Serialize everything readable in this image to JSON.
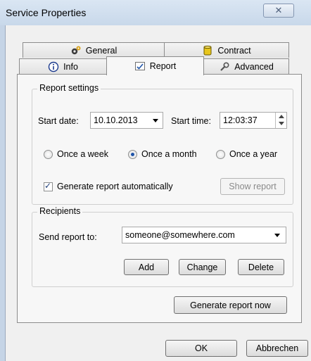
{
  "window": {
    "title": "Service Properties",
    "close_glyph": "✕"
  },
  "tabs_back": [
    {
      "label": "General",
      "icon": "gears-icon"
    },
    {
      "label": "Contract",
      "icon": "database-icon"
    }
  ],
  "tabs_front": [
    {
      "label": "Info",
      "icon": "info-icon"
    },
    {
      "label": "Report",
      "icon": "report-icon",
      "active": true
    },
    {
      "label": "Advanced",
      "icon": "wrench-icon"
    }
  ],
  "report_settings": {
    "legend": "Report settings",
    "start_date_label": "Start date:",
    "start_date_value": "10.10.2013",
    "start_time_label": "Start time:",
    "start_time_value": "12:03:37",
    "frequency_options": [
      "Once a week",
      "Once a month",
      "Once a year"
    ],
    "frequency_selected": "Once a month",
    "auto_generate_label": "Generate report automatically",
    "auto_generate_checked": true,
    "show_report_label": "Show report"
  },
  "recipients": {
    "legend": "Recipients",
    "send_to_label": "Send report to:",
    "send_to_value": "someone@somewhere.com",
    "add_label": "Add",
    "change_label": "Change",
    "delete_label": "Delete"
  },
  "generate_now_label": "Generate report now",
  "footer": {
    "ok_label": "OK",
    "cancel_label": "Abbrechen"
  },
  "colors": {
    "accent": "#1f54a8",
    "title_bar": "#dae6f3"
  }
}
